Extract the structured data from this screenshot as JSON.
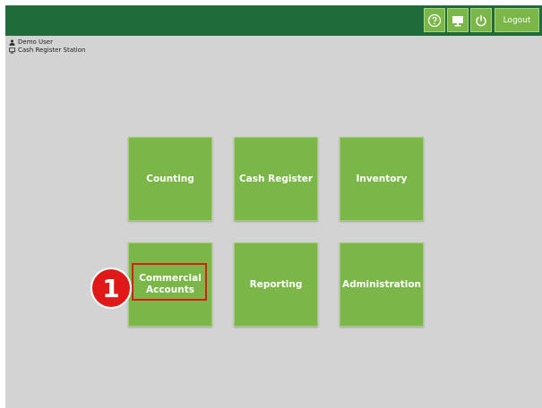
{
  "topbar": {
    "help_icon": "question-circle-icon",
    "station_icon": "monitor-icon",
    "power_icon": "power-icon",
    "logout_label": "Logout"
  },
  "user": {
    "name": "Demo User",
    "station": "Cash Register Station"
  },
  "tiles": [
    {
      "label": "Counting"
    },
    {
      "label": "Cash Register"
    },
    {
      "label": "Inventory"
    },
    {
      "label": "Commercial\nAccounts"
    },
    {
      "label": "Reporting"
    },
    {
      "label": "Administration"
    }
  ],
  "annotation": {
    "step_number": "1",
    "highlight_color": "#e01818"
  },
  "colors": {
    "topbar": "#1f6b3a",
    "tile": "#7ab648",
    "background": "#d3d3d3"
  }
}
